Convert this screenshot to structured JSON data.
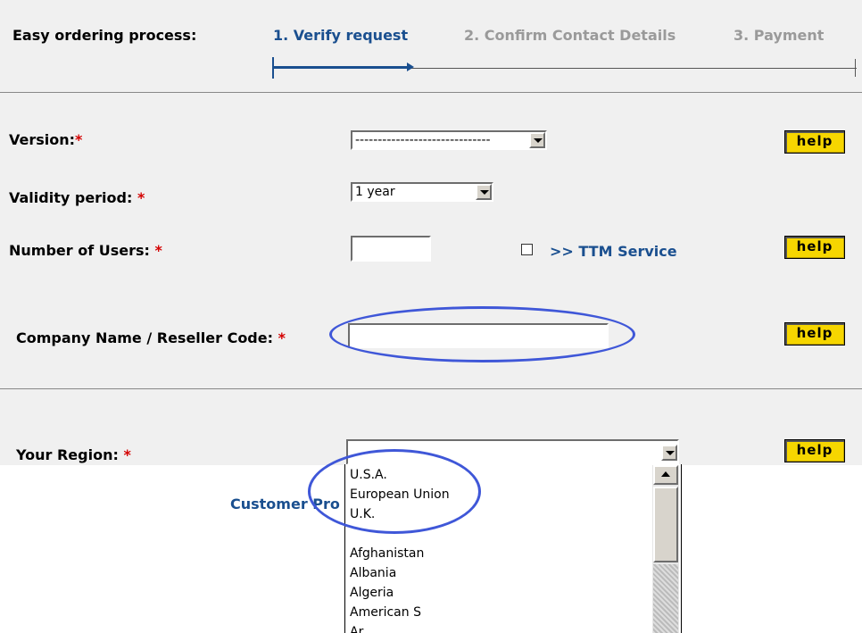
{
  "header": {
    "title": "Easy ordering process:",
    "steps": [
      "1. Verify request",
      "2. Confirm Contact Details",
      "3. Payment"
    ]
  },
  "form": {
    "version": {
      "label": "Version:",
      "required": "*",
      "value": "------------------------------"
    },
    "validity": {
      "label": "Validity period:",
      "required": "*",
      "value": "1 year"
    },
    "users": {
      "label": "Number of Users:",
      "required": "*",
      "value": ""
    },
    "ttm_link": ">> TTM Service",
    "company": {
      "label": "Company Name / Reseller Code:",
      "required": "*",
      "value": ""
    },
    "region": {
      "label": "Your Region:",
      "required": "*",
      "value": "",
      "options": [
        "U.S.A.",
        "European Union",
        "U.K.",
        "",
        "Afghanistan",
        "Albania",
        "Algeria",
        "American S",
        "Ar..."
      ]
    },
    "help_label": "help"
  },
  "partial_link": "Customer Pro",
  "colors": {
    "step_active": "#1a4f8f",
    "step_inactive": "#9a9a9a",
    "required": "#d40000",
    "help_button": "#f6d600",
    "highlight_ellipse": "#3f57d8"
  },
  "icons": {
    "dropdown": "chevron-down-icon",
    "scroll_up": "arrow-up-icon"
  }
}
